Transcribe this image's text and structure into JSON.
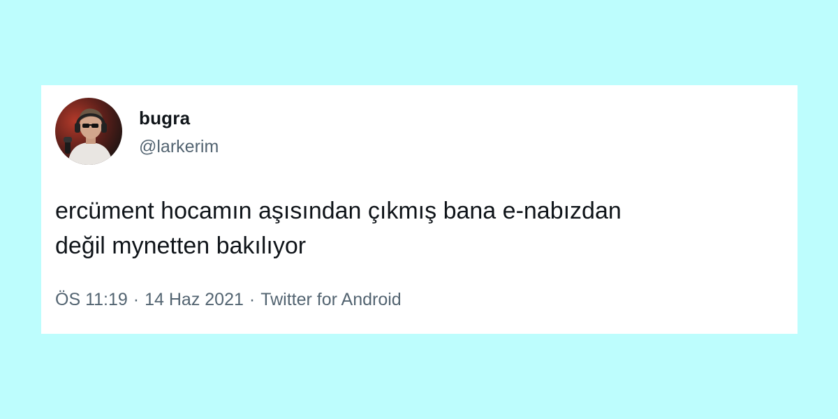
{
  "tweet": {
    "author": {
      "display_name": "bugra",
      "handle": "@larkerim",
      "avatar_icon": "profile-photo"
    },
    "text_lines": [
      "ercüment hocamın aşısından çıkmış bana e-nabızdan",
      "değil mynetten bakılıyor"
    ],
    "meta": {
      "time": "ÖS 11:19",
      "date": "14 Haz 2021",
      "source": "Twitter for Android",
      "separator": "·"
    }
  },
  "colors": {
    "page_background": "#bdfdfd",
    "card_background": "#ffffff",
    "primary_text": "#0f1419",
    "secondary_text": "#536471"
  }
}
